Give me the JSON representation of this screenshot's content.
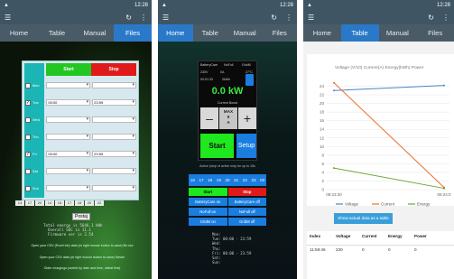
{
  "phones": [
    {
      "status_time": "12:28",
      "tabs": [
        "Home",
        "Table",
        "Manual",
        "Files"
      ],
      "active_tab": 3
    },
    {
      "status_time": "12:28",
      "tabs": [
        "Home",
        "Table",
        "Manual",
        "Files"
      ],
      "active_tab": 0
    },
    {
      "status_time": "12:28",
      "tabs": [
        "Home",
        "Table",
        "Manual",
        "Files"
      ],
      "active_tab": 1
    }
  ],
  "files": {
    "start_label": "Start",
    "stop_label": "Stop",
    "days": [
      {
        "day": "Mon",
        "checked": false,
        "start": "",
        "stop": ""
      },
      {
        "day": "Tue",
        "checked": true,
        "start": "00:00",
        "stop": "23:59"
      },
      {
        "day": "Wed",
        "checked": false,
        "start": "",
        "stop": ""
      },
      {
        "day": "Thu",
        "checked": false,
        "start": "",
        "stop": ""
      },
      {
        "day": "Fri",
        "checked": true,
        "start": "00:00",
        "stop": "23:59"
      },
      {
        "day": "Sat",
        "checked": false,
        "start": "",
        "stop": ""
      },
      {
        "day": "Sun",
        "checked": false,
        "start": "",
        "stop": ""
      }
    ],
    "slots": [
      "14",
      "17",
      "20",
      "14",
      "16",
      "17",
      "18",
      "20",
      "22"
    ],
    "apply": "Postaj",
    "info": "Total energy is 5646.1 kWh\n  Overall SOC is 11.1\n  Firmware ver is 2.54",
    "notes": [
      "Open your CSV (Excel etc) data (or right mouse button to save) file.csv",
      "Open your CSV data (or right mouse button to save) Newer",
      "Older chargings (sorted by date and time, oldest first)"
    ]
  },
  "home": {
    "labels": [
      "BatteryCare",
      "NoFull",
      "GridM"
    ],
    "v1": "230V",
    "v2": "0A",
    "v3": "27°C",
    "time": "00:01:33",
    "energy": "0kWh",
    "power": "0.0 kW",
    "current_boost": "Current Boost",
    "minus": "–",
    "plus": "+",
    "max": "MAX",
    "max_val": "9",
    "amp": "A",
    "start": "Start",
    "setup": "Setup",
    "note": "Active (stop of active may be up to 15s",
    "hours": [
      "16",
      "17",
      "18",
      "19",
      "20",
      "21",
      "22",
      "23",
      "00"
    ],
    "start_btn": "Start",
    "stop_btn": "Stop",
    "bc_on": "BatteryCare on",
    "bc_off": "BatteryCare off",
    "nf_on": "NoFull on",
    "nf_off": "NoFull off",
    "gm_on": "GridM on",
    "gm_off": "GridM off",
    "schedule": "Mon:\nTue: 00:00 - 23:59\nWed:\nThu:\nFri: 00:00 - 23:59\nSat:\nSun:"
  },
  "table": {
    "title": "Voltage (V/10) Current(A) Energy(kWh) Power",
    "y_ticks": [
      "24",
      "22",
      "20",
      "18",
      "16",
      "14",
      "12",
      "10",
      "8",
      "6",
      "4",
      "2",
      "0"
    ],
    "x_ticks": [
      "08:23:30",
      "08:24:0"
    ],
    "legend": [
      "Voltage",
      "Current",
      "Energy"
    ],
    "show_btn": "Show actual data as a table",
    "headers": [
      "Index",
      "Voltage",
      "Current",
      "Energy",
      "Power"
    ],
    "row": [
      "11:59:46",
      "230",
      "0",
      "0",
      "0"
    ]
  },
  "chart_data": {
    "type": "line",
    "title": "Voltage (V/10) Current(A) Energy(kWh) Power",
    "x": [
      "08:23:30",
      "08:24:0"
    ],
    "ylim": [
      0,
      26
    ],
    "series": [
      {
        "name": "Voltage",
        "color": "#4a86c8",
        "values": [
          23.0,
          24.2
        ]
      },
      {
        "name": "Current",
        "color": "#e8702a",
        "values": [
          24.8,
          0.5
        ]
      },
      {
        "name": "Energy",
        "color": "#6aa832",
        "values": [
          5.0,
          0.3
        ]
      }
    ]
  }
}
